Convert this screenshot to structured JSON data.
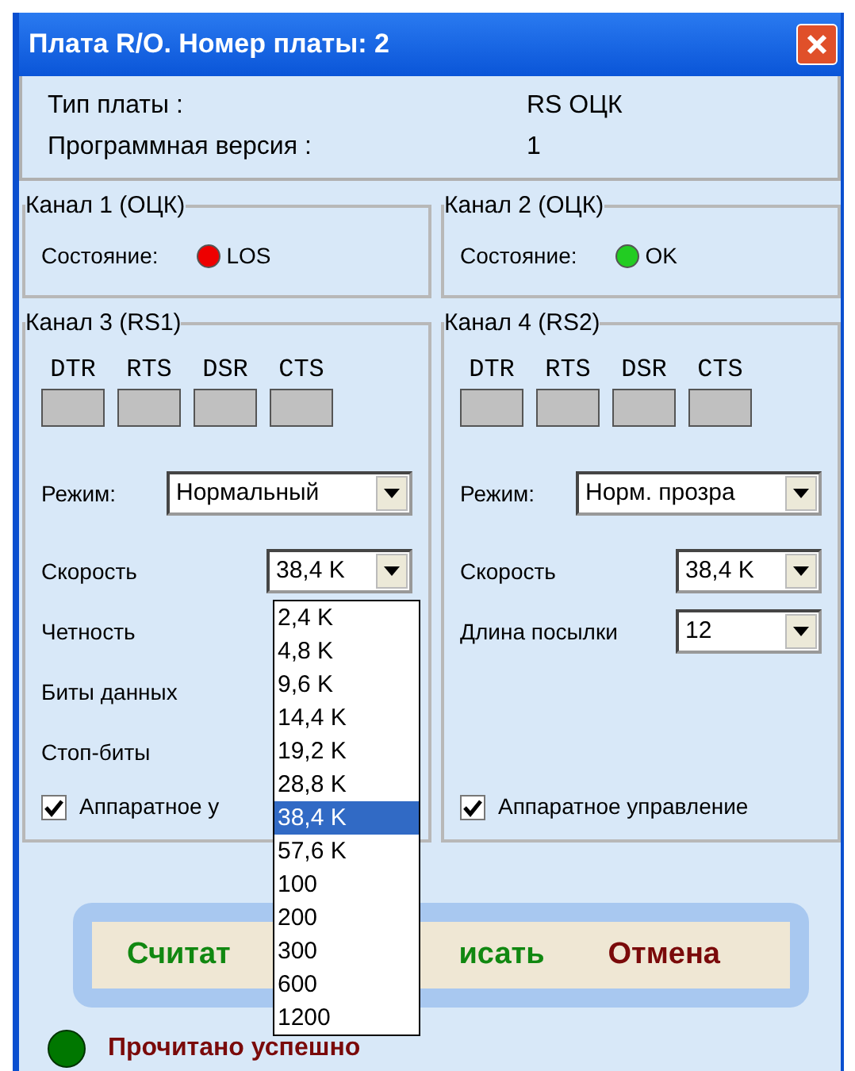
{
  "window": {
    "title": "Плата R/O. Номер платы: 2"
  },
  "info": [
    {
      "label": "Тип платы :",
      "value": "RS ОЦК"
    },
    {
      "label": "Программная версия :",
      "value": "1"
    }
  ],
  "status_channels": [
    {
      "title": "Канал 1 (ОЦК)",
      "label": "Состояние:",
      "color": "#ee0000",
      "status": "LOS"
    },
    {
      "title": "Канал 2 (ОЦК)",
      "label": "Состояние:",
      "color": "#22cc22",
      "status": "OK"
    }
  ],
  "serial_channels": [
    {
      "title": "Канал 3 (RS1)",
      "signals": [
        "DTR",
        "RTS",
        "DSR",
        "CTS"
      ],
      "fields": [
        {
          "kind": "mode",
          "label": "Режим:",
          "value": "Нормальный"
        },
        {
          "kind": "select",
          "label": "Скорость",
          "value": "38,4 K"
        },
        {
          "kind": "label",
          "label": "Четность"
        },
        {
          "kind": "label",
          "label": "Биты данных"
        },
        {
          "kind": "label",
          "label": "Стоп-биты"
        }
      ],
      "hardware_control": {
        "label": "Аппаратное у",
        "checked": true
      }
    },
    {
      "title": "Канал 4 (RS2)",
      "signals": [
        "DTR",
        "RTS",
        "DSR",
        "CTS"
      ],
      "fields": [
        {
          "kind": "mode",
          "label": "Режим:",
          "value": "Норм. прозра"
        },
        {
          "kind": "select",
          "label": "Скорость",
          "value": "38,4 K"
        },
        {
          "kind": "select",
          "label": "Длина посылки",
          "value": "12"
        }
      ],
      "hardware_control": {
        "label": "Аппаратное управление",
        "checked": true
      }
    }
  ],
  "dropdown": {
    "items": [
      {
        "label": "2,4 K",
        "selected": false
      },
      {
        "label": "4,8 K",
        "selected": false
      },
      {
        "label": "9,6 K",
        "selected": false
      },
      {
        "label": "14,4 K",
        "selected": false
      },
      {
        "label": "19,2 K",
        "selected": false
      },
      {
        "label": "28,8 K",
        "selected": false
      },
      {
        "label": "38,4 K",
        "selected": true
      },
      {
        "label": "57,6 K",
        "selected": false
      },
      {
        "label": "100",
        "selected": false
      },
      {
        "label": "200",
        "selected": false
      },
      {
        "label": "300",
        "selected": false
      },
      {
        "label": "600",
        "selected": false
      },
      {
        "label": "1200",
        "selected": false
      }
    ]
  },
  "buttons": [
    {
      "label": "Считат",
      "kind": "read"
    },
    {
      "label": "исать",
      "kind": "write"
    },
    {
      "label": "Отмена",
      "kind": "cancel"
    }
  ],
  "status": {
    "text": "Прочитано успешно",
    "color": "#007700"
  }
}
